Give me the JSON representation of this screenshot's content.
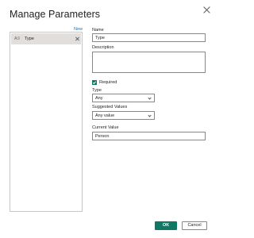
{
  "dialog": {
    "title": "Manage Parameters",
    "close_icon": "close-icon"
  },
  "params": {
    "new_label": "New",
    "items": [
      {
        "label": "Type",
        "icon": "parameter-icon",
        "icon_glyph": "Aℬ",
        "remove_icon": "close-icon"
      }
    ]
  },
  "form": {
    "name_label": "Name",
    "name_value": "Type",
    "description_label": "Description",
    "description_value": "",
    "required_label": "Required",
    "required_checked": true,
    "type_label": "Type",
    "type_value": "Any",
    "suggested_label": "Suggested Values",
    "suggested_value": "Any value",
    "current_label": "Current Value",
    "current_value": "Person"
  },
  "buttons": {
    "ok_label": "OK",
    "cancel_label": "Cancel"
  },
  "colors": {
    "accent": "#117865",
    "link": "#0078d4",
    "border": "#8a8886",
    "selection": "#e1dfdd"
  }
}
